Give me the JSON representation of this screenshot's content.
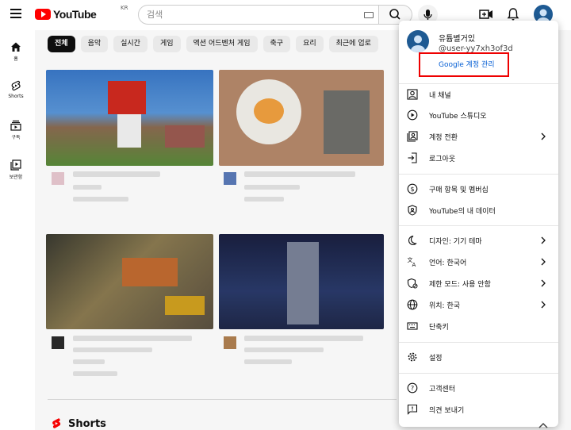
{
  "header": {
    "logo_text": "YouTube",
    "country_code": "KR",
    "search_placeholder": "검색"
  },
  "guide": [
    {
      "label": "홈",
      "icon": "home-icon"
    },
    {
      "label": "Shorts",
      "icon": "shorts-icon"
    },
    {
      "label": "구독",
      "icon": "subscriptions-icon"
    },
    {
      "label": "보관함",
      "icon": "library-icon"
    }
  ],
  "chips": [
    "전체",
    "음악",
    "실시간",
    "게임",
    "액션 어드벤처 게임",
    "축구",
    "요리",
    "최근에 업로"
  ],
  "section": {
    "shorts_label": "Shorts"
  },
  "account_menu": {
    "name": "유튭별거있",
    "handle": "@user-yy7xh3of3d",
    "manage_link": "Google 계정 관리",
    "group1": [
      {
        "label": "내 채널",
        "icon": "person-icon",
        "submenu": false
      },
      {
        "label": "YouTube 스튜디오",
        "icon": "studio-icon",
        "submenu": false
      },
      {
        "label": "계정 전환",
        "icon": "switch-account-icon",
        "submenu": true
      },
      {
        "label": "로그아웃",
        "icon": "sign-out-icon",
        "submenu": false
      }
    ],
    "group2": [
      {
        "label": "구매 항목 및 멤버십",
        "icon": "dollar-icon",
        "submenu": false
      },
      {
        "label": "YouTube의 내 데이터",
        "icon": "shield-person-icon",
        "submenu": false
      }
    ],
    "group3": [
      {
        "label": "디자인: 기기 테마",
        "icon": "moon-icon",
        "submenu": true
      },
      {
        "label": "언어: 한국어",
        "icon": "translate-icon",
        "submenu": true
      },
      {
        "label": "제한 모드: 사용 안함",
        "icon": "restricted-icon",
        "submenu": true
      },
      {
        "label": "위치: 한국",
        "icon": "globe-icon",
        "submenu": true
      },
      {
        "label": "단축키",
        "icon": "keyboard-icon",
        "submenu": false
      }
    ],
    "group4": [
      {
        "label": "설정",
        "icon": "gear-icon",
        "submenu": false
      }
    ],
    "group5": [
      {
        "label": "고객센터",
        "icon": "help-icon",
        "submenu": false
      },
      {
        "label": "의견 보내기",
        "icon": "feedback-icon",
        "submenu": false
      }
    ]
  },
  "colors": {
    "brand": "#ff0000",
    "link": "#065fd4",
    "highlight": "#e00000",
    "avatar": "#1e5a93"
  }
}
